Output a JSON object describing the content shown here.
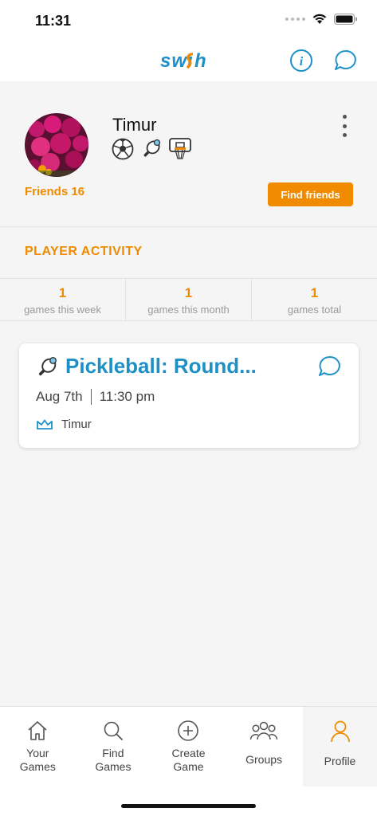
{
  "status_bar": {
    "time": "11:31"
  },
  "header": {
    "logo": "swish",
    "icons": [
      "info-icon",
      "chat-icon"
    ]
  },
  "profile": {
    "name": "Timur",
    "sports": [
      "soccer-ball-icon",
      "pickleball-paddle-icon",
      "basketball-hoop-icon"
    ],
    "friends_label": "Friends 16",
    "find_friends_label": "Find friends"
  },
  "activity": {
    "title": "PLAYER ACTIVITY",
    "stats": [
      {
        "value": "1",
        "label": "games this week"
      },
      {
        "value": "1",
        "label": "games this month"
      },
      {
        "value": "1",
        "label": "games total"
      }
    ]
  },
  "games": [
    {
      "title": "Pickleball: Round...",
      "date": "Aug 7th",
      "time": "11:30 pm",
      "host": "Timur"
    }
  ],
  "tabs": [
    {
      "label": "Your Games",
      "icon": "home-icon",
      "active": false
    },
    {
      "label": "Find Games",
      "icon": "search-icon",
      "active": false
    },
    {
      "label": "Create Game",
      "icon": "plus-circle-icon",
      "active": false
    },
    {
      "label": "Groups",
      "icon": "groups-icon",
      "active": false
    },
    {
      "label": "Profile",
      "icon": "person-icon",
      "active": true
    }
  ],
  "colors": {
    "accent_orange": "#f08a00",
    "accent_blue": "#1e90c8"
  }
}
